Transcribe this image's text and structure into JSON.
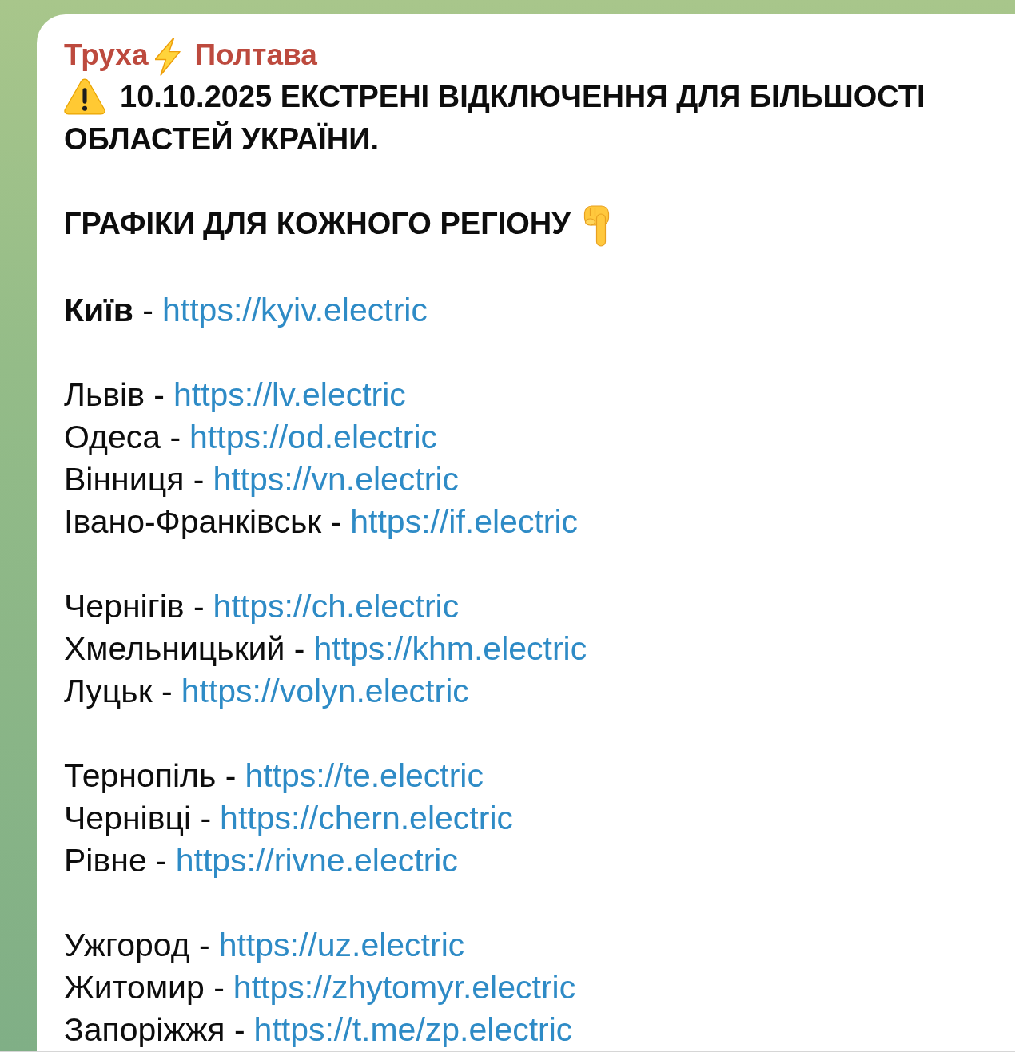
{
  "channel_title": {
    "before_icon": "Труха",
    "after_icon": "Полтава"
  },
  "headline_lines": [
    "10.10.2025 ЕКСТРЕНІ ВІДКЛЮЧЕННЯ ДЛЯ БІЛЬШОСТІ",
    "ОБЛАСТЕЙ УКРАЇНИ."
  ],
  "subheading": "ГРАФІКИ ДЛЯ КОЖНОГО РЕГІОНУ",
  "region_groups": [
    [
      {
        "label": "**Київ** -",
        "url": "https://kyiv.electric"
      }
    ],
    [
      {
        "label": "Львів -",
        "url": "https://lv.electric"
      },
      {
        "label": "Одеса -",
        "url": "https://od.electric"
      },
      {
        "label": "Вінниця -",
        "url": "https://vn.electric"
      },
      {
        "label": "Івано-Франківськ -",
        "url": "https://if.electric"
      }
    ],
    [
      {
        "label": "Чернігів -",
        "url": "https://ch.electric"
      },
      {
        "label": "Хмельницький -",
        "url": "https://khm.electric"
      },
      {
        "label": "Луцьк -",
        "url": "https://volyn.electric"
      }
    ],
    [
      {
        "label": "Тернопіль -",
        "url": "https://te.electric"
      },
      {
        "label": "Чернівці -",
        "url": "https://chern.electric"
      },
      {
        "label": "Рівне -",
        "url": "https://rivne.electric"
      }
    ],
    [
      {
        "label": "Ужгород -",
        "url": "https://uz.electric"
      },
      {
        "label": "Житомир -",
        "url": "https://zhytomyr.electric"
      },
      {
        "label": "Запоріжжя -",
        "url": "https://t.me/zp.electric"
      }
    ]
  ]
}
